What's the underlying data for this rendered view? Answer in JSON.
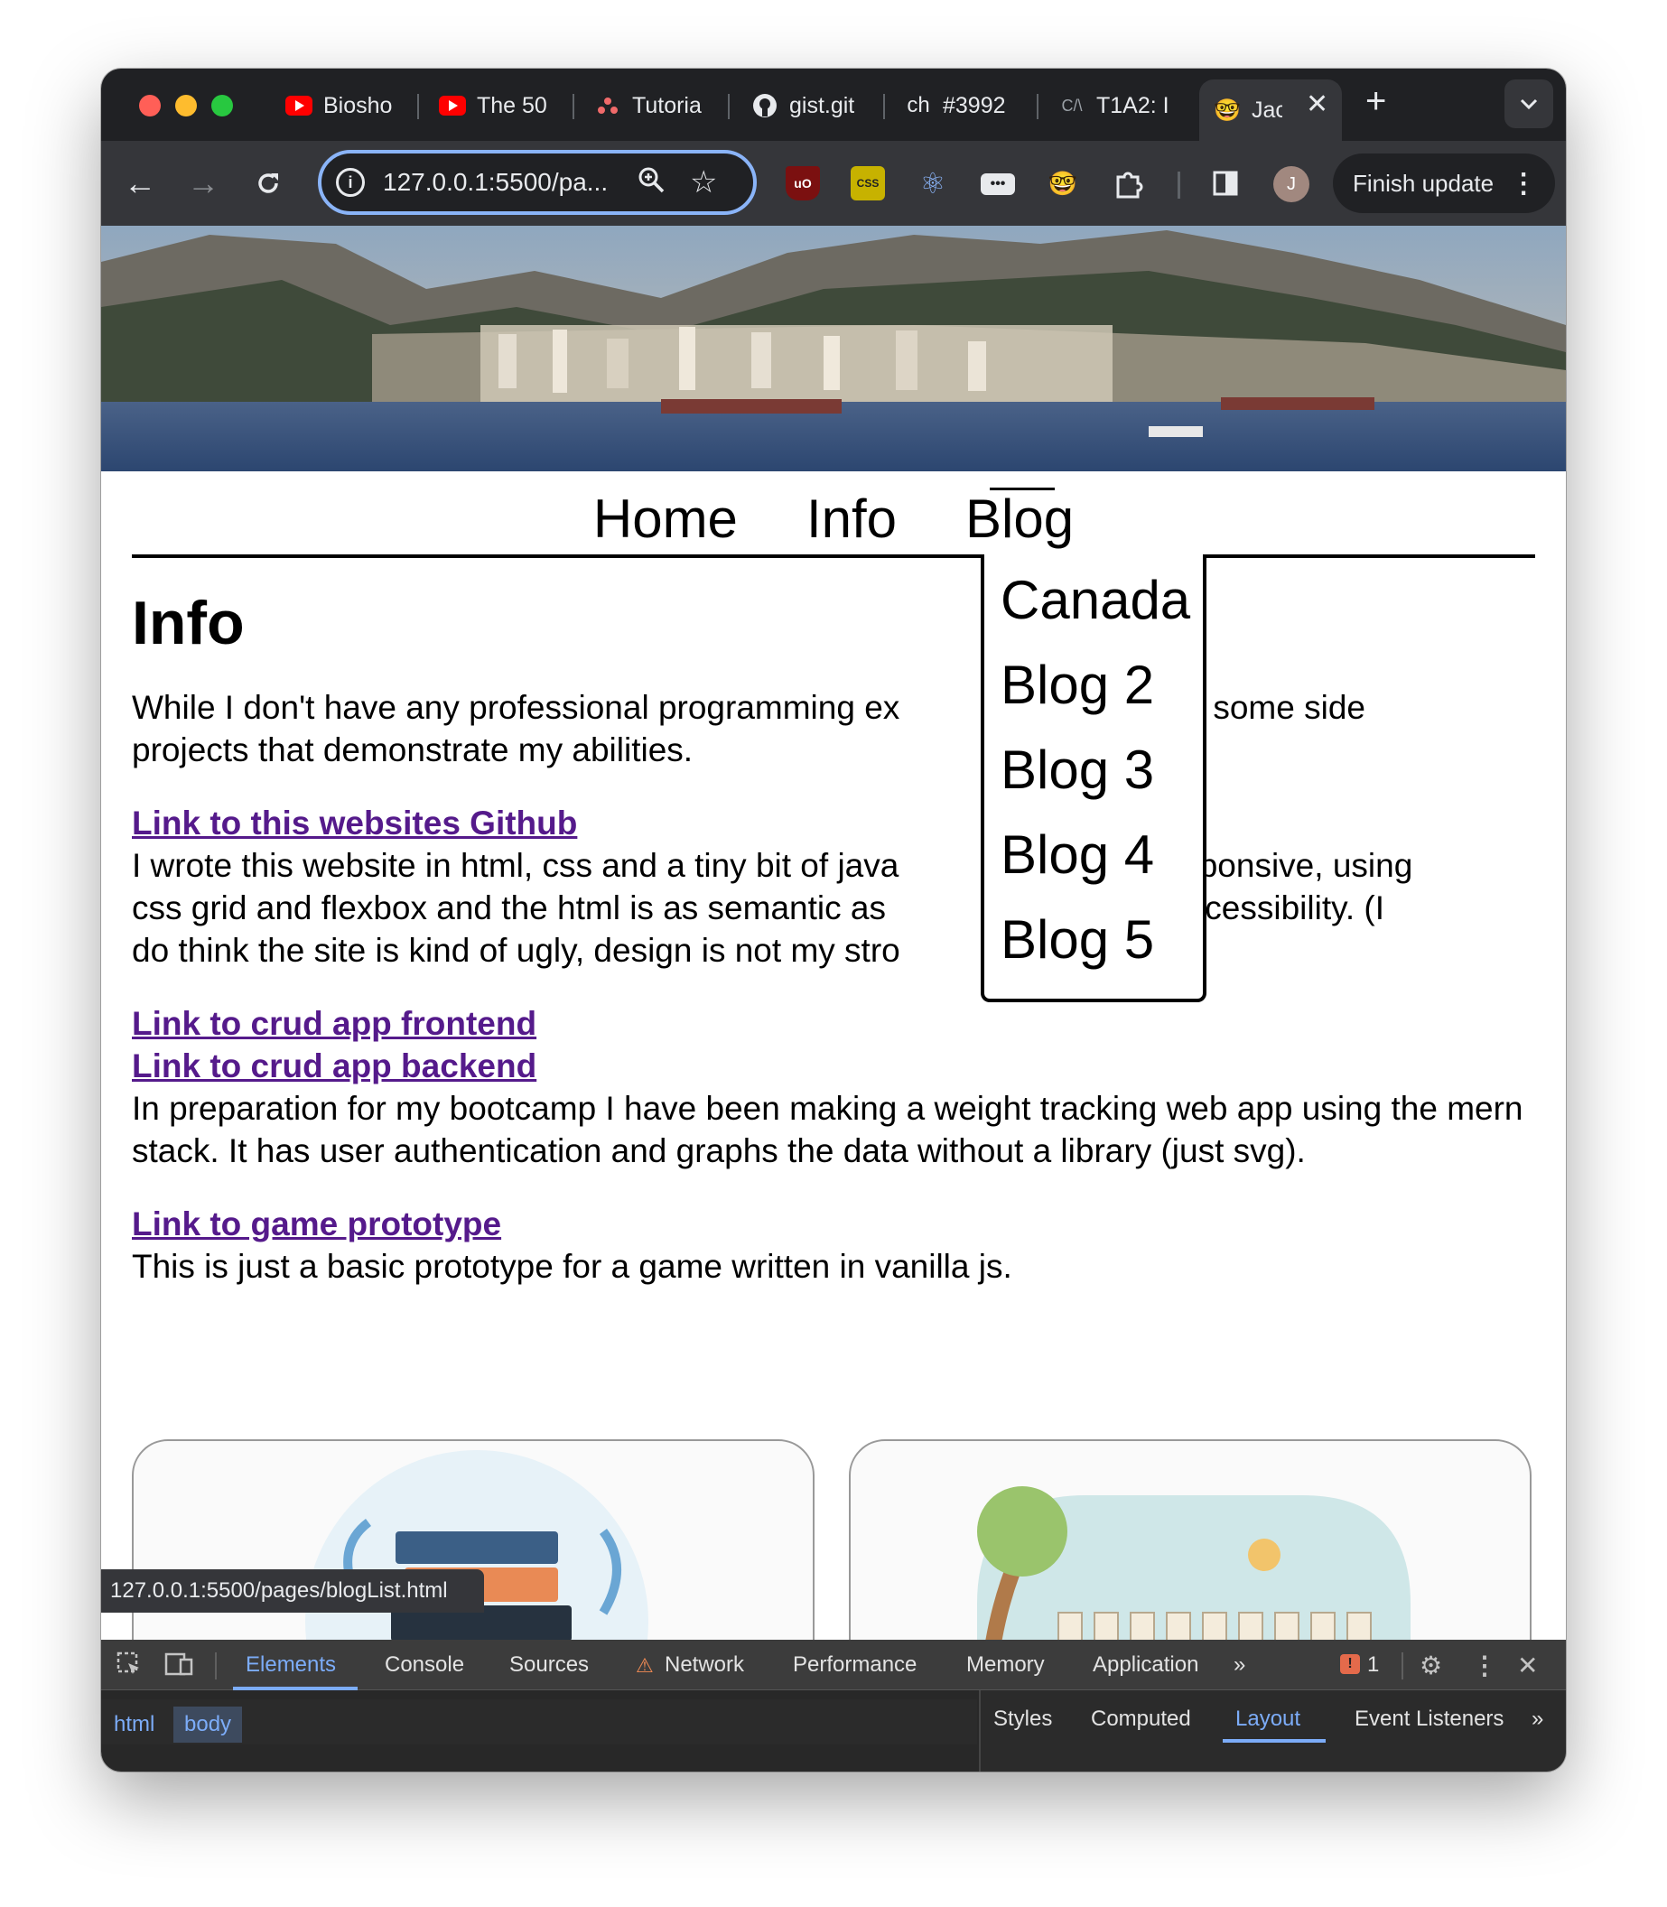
{
  "browser": {
    "tabs": [
      {
        "title": "Biosho",
        "favicon": "youtube-icon"
      },
      {
        "title": "The 50",
        "favicon": "youtube-icon"
      },
      {
        "title": "Tutoria",
        "favicon": "asana-icon"
      },
      {
        "title": "gist.git",
        "favicon": "github-icon"
      },
      {
        "title": "#3992",
        "favicon": "ch",
        "favicon_text": "ch"
      },
      {
        "title": "T1A2: I",
        "favicon": "canvas-icon",
        "favicon_text": "C/\\"
      },
      {
        "title": "Jac",
        "favicon": "nerd-face-icon",
        "active": true
      }
    ],
    "url": "127.0.0.1:5500/pa...",
    "finish_update_label": "Finish update",
    "avatar_initial": "J",
    "status_url": "127.0.0.1:5500/pages/blogList.html",
    "accent_color": "#8ab4f8"
  },
  "page": {
    "nav": {
      "home": "Home",
      "info": "Info",
      "blog": "Blog",
      "blog_dropdown": [
        "Canada",
        "Blog 2",
        "Blog 3",
        "Blog 4",
        "Blog 5"
      ]
    },
    "heading": "Info",
    "intro_a": "While I don't have any professional programming ex",
    "intro_b": "have some side",
    "intro_c": "projects that demonstrate my abilities.",
    "link_github": "Link to this websites Github",
    "github_desc_1a": "I wrote this website in html, css and a tiny bit of java",
    "github_desc_1b": "ly responsive, using",
    "github_desc_2a": "css grid and flexbox and the html is as semantic as",
    "github_desc_2b": "sure accessibility. (I",
    "github_desc_3": "do think the site is kind of ugly, design is not my stro",
    "link_crud_frontend": "Link to crud app frontend",
    "link_crud_backend": "Link to crud app backend",
    "crud_desc": "In preparation for my bootcamp I have been making a weight tracking web app using the mern stack. It has user authentication and graphs the data without a library (just svg).",
    "link_game": "Link to game prototype",
    "game_desc": "This is just a basic prototype for a game written in vanilla js.",
    "link_color": "#551a8b"
  },
  "devtools": {
    "tabs": [
      "Elements",
      "Console",
      "Sources",
      "Network",
      "Performance",
      "Memory",
      "Application"
    ],
    "active_tab": "Elements",
    "issues_count": "1",
    "breadcrumbs": [
      "html",
      "body"
    ],
    "side_tabs": [
      "Styles",
      "Computed",
      "Layout",
      "Event Listeners"
    ],
    "active_side_tab": "Layout"
  }
}
